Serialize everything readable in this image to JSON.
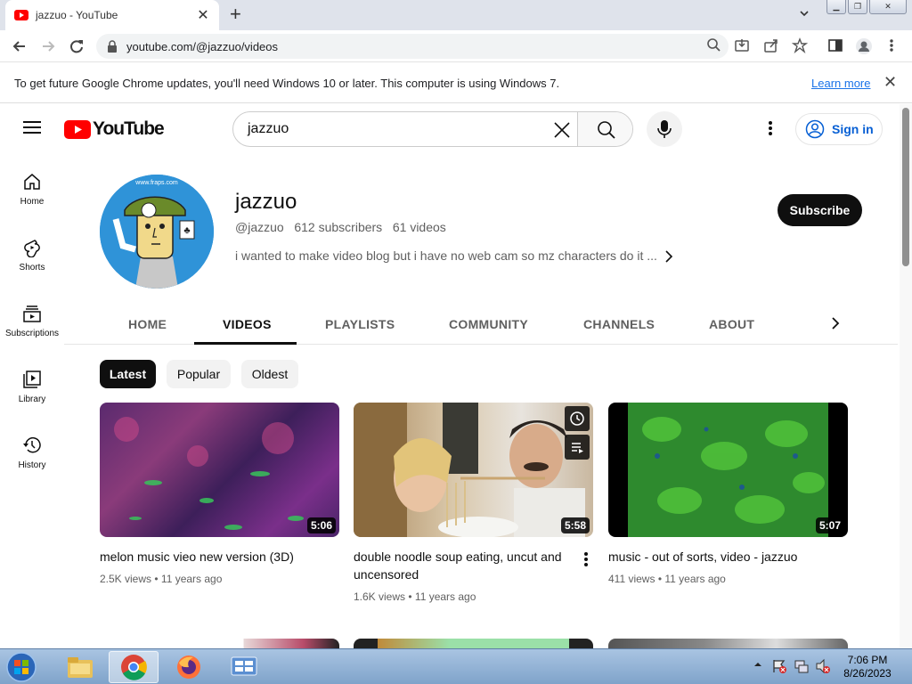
{
  "browser": {
    "tab_title": "jazzuo - YouTube",
    "url": "youtube.com/@jazzuo/videos",
    "infobar_message": "To get future Google Chrome updates, you'll need Windows 10 or later. This computer is using Windows 7.",
    "infobar_link": "Learn more"
  },
  "youtube": {
    "logo_text": "YouTube",
    "search_query": "jazzuo",
    "sign_in": "Sign in",
    "nav": [
      {
        "label": "Home"
      },
      {
        "label": "Shorts"
      },
      {
        "label": "Subscriptions"
      },
      {
        "label": "Library"
      },
      {
        "label": "History"
      }
    ],
    "channel": {
      "name": "jazzuo",
      "handle": "@jazzuo",
      "subscribers": "612 subscribers",
      "video_count": "61 videos",
      "description": "i wanted to make video blog but i have no web cam so mz characters do it ...",
      "subscribe": "Subscribe",
      "avatar_caption": "www.fraps.com"
    },
    "tabs": [
      "HOME",
      "VIDEOS",
      "PLAYLISTS",
      "COMMUNITY",
      "CHANNELS",
      "ABOUT"
    ],
    "active_tab": "VIDEOS",
    "chips": [
      "Latest",
      "Popular",
      "Oldest"
    ],
    "videos": [
      {
        "title": "melon music vieo new version (3D)",
        "duration": "5:06",
        "views": "2.5K views",
        "age": "11 years ago"
      },
      {
        "title": "double noodle soup eating, uncut and uncensored",
        "duration": "5:58",
        "views": "1.6K views",
        "age": "11 years ago"
      },
      {
        "title": "music - out of sorts, video - jazzuo",
        "duration": "5:07",
        "views": "411 views",
        "age": "11 years ago"
      }
    ]
  },
  "taskbar": {
    "time": "7:06 PM",
    "date": "8/26/2023"
  },
  "colors": {
    "youtube_red": "#ff0000",
    "link_blue": "#065fd4",
    "chrome_tabstrip": "#dfe3eb"
  }
}
